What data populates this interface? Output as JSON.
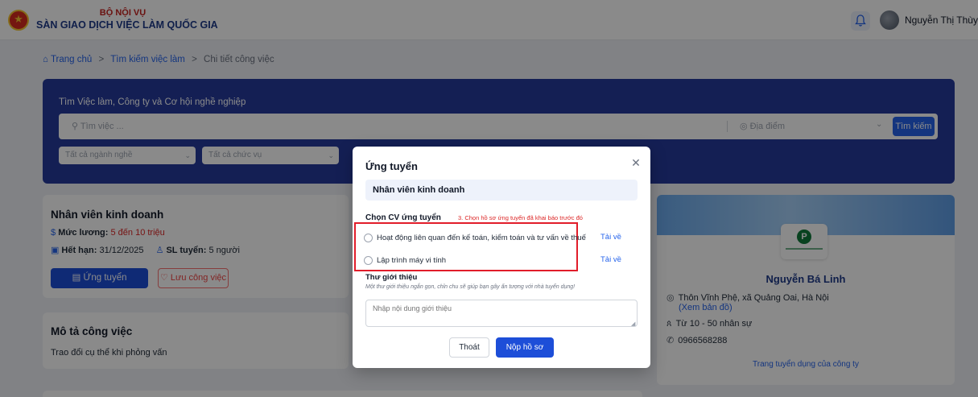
{
  "header": {
    "ministry": "BỘ NỘI VỤ",
    "site_name": "SÀN GIAO DỊCH VIỆC LÀM QUỐC GIA",
    "user_name": "Nguyễn Thị Thùy Liên"
  },
  "breadcrumb": {
    "home": "Trang chủ",
    "search": "Tìm kiếm việc làm",
    "current": "Chi tiết công việc",
    "separator": ">"
  },
  "search": {
    "title": "Tìm Việc làm, Công ty và Cơ hội nghề nghiệp",
    "keyword_placeholder": "Tìm việc ...",
    "location_placeholder": "Địa điểm",
    "button": "Tìm kiếm",
    "industry_select": "Tất cả ngành nghề",
    "position_select": "Tất cả chức vụ"
  },
  "job": {
    "title": "Nhân viên kinh doanh",
    "salary_label": "Mức lương:",
    "salary_value": "5 đến 10 triệu",
    "deadline_label": "Hết hạn:",
    "deadline_value": "31/12/2025",
    "quantity_label": "SL tuyển:",
    "quantity_value": "5 người",
    "apply_button": "Ứng tuyển",
    "save_button": "Lưu công việc"
  },
  "description": {
    "title": "Mô tả công việc",
    "text": "Trao đổi cụ thể khi phỏng vấn"
  },
  "company": {
    "name": "Nguyễn Bá Linh",
    "address": "Thôn Vĩnh Phệ, xã Quảng Oai, Hà Nội",
    "map_link": "(Xem bản đồ)",
    "size": "Từ 10 - 50 nhân sự",
    "phone": "0966568288",
    "page_link": "Trang tuyển dụng của công ty"
  },
  "modal": {
    "title": "Ứng tuyển",
    "job_title": "Nhân viên kinh doanh",
    "cv_label": "Chọn CV ứng tuyển",
    "annotation": "3. Chọn hồ sơ ứng tuyển đã khai báo trước đó",
    "cvs": [
      {
        "name": "Hoạt động liên quan đến kế toán, kiểm toán và tư vấn về thuế",
        "download": "Tải về"
      },
      {
        "name": "Lập trình máy vi tính",
        "download": "Tải về"
      }
    ],
    "intro_label": "Thư giới thiệu",
    "intro_hint": "Một thư giới thiệu ngắn gọn, chỉn chu sẽ giúp bạn gây ấn tượng với nhà tuyển dụng!",
    "intro_placeholder": "Nhập nội dung giới thiệu",
    "cancel_button": "Thoát",
    "submit_button": "Nộp hồ sơ"
  },
  "colors": {
    "primary": "#1d4ed8",
    "search_panel": "#253a9c",
    "annotation_red": "#e11d2a",
    "salary_red": "#dc2626"
  }
}
